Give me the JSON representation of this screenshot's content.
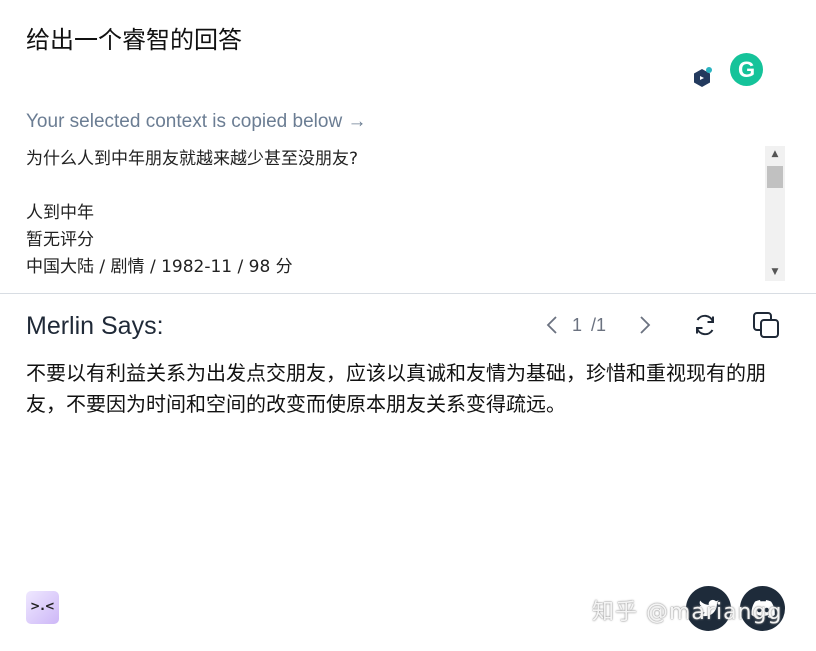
{
  "header": {
    "prompt_title": "给出一个睿智的回答"
  },
  "extension_icons": [
    "hexagon-extension-icon",
    "grammarly-icon"
  ],
  "grammarly_letter": "G",
  "context": {
    "label": "Your selected context is copied below →",
    "lines": [
      "为什么人到中年朋友就越来越少甚至没朋友?",
      "",
      "人到中年",
      "暂无评分",
      "中国大陆 / 剧情 / 1982-11 / 98 分"
    ]
  },
  "response": {
    "title": "Merlin Says:",
    "pager_current": "1",
    "pager_total": "/1",
    "answer": "不要以有利益关系为出发点交朋友，应该以真诚和友情为基础，珍惜和重视现有的朋友，不要因为时间和空间的改变而使原本朋友关系变得疏远。"
  },
  "footer": {
    "logo_text": ">.<",
    "watermark": "知乎 @mariangg"
  },
  "colors": {
    "label_gray": "#6b7d93",
    "grammarly_green": "#15c39a",
    "social_bg": "#1e2b3a"
  }
}
